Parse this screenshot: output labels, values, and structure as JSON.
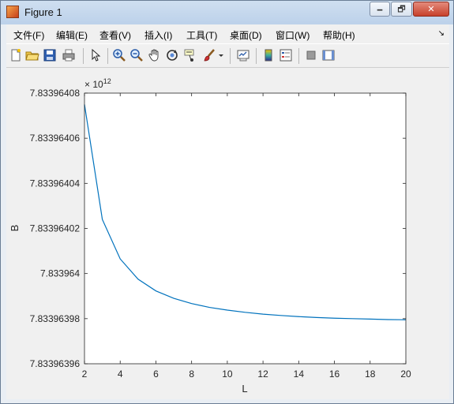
{
  "window": {
    "title": "Figure 1",
    "minimize_symbol": "🗕",
    "maximize_symbol": "🗗",
    "close_symbol": "✕"
  },
  "menu": {
    "items": [
      "文件(F)",
      "编辑(E)",
      "查看(V)",
      "插入(I)",
      "工具(T)",
      "桌面(D)",
      "窗口(W)",
      "帮助(H)"
    ],
    "dock_arrow": "↘"
  },
  "toolbar": {
    "icons": [
      "new-figure-icon",
      "open-file-icon",
      "save-icon",
      "print-icon",
      "pointer-arrow-icon",
      "zoom-in-icon",
      "zoom-out-icon",
      "pan-hand-icon",
      "rotate-3d-icon",
      "data-cursor-icon",
      "brush-icon",
      "brush-dropdown-icon",
      "link-plot-icon",
      "colorbar-icon",
      "legend-icon",
      "hide-plot-tools-icon",
      "show-plot-tools-icon"
    ]
  },
  "chart_data": {
    "type": "line",
    "xlabel": "L",
    "ylabel": "B",
    "exponent_label": "× 10",
    "exponent_power": "12",
    "xlim": [
      2,
      20
    ],
    "ylim": [
      7.83396396,
      7.83396408
    ],
    "xticks": [
      "2",
      "4",
      "6",
      "8",
      "10",
      "12",
      "14",
      "16",
      "18",
      "20"
    ],
    "yticks": [
      "7.83396396",
      "7.83396398",
      "7.833964",
      "7.83396402",
      "7.83396404",
      "7.83396406",
      "7.83396408"
    ],
    "line_color": "#0072bd",
    "series": [
      {
        "x": [
          2,
          3,
          4,
          5,
          6,
          7,
          8,
          9,
          10,
          11,
          12,
          13,
          14,
          15,
          16,
          17,
          18,
          19,
          20
        ],
        "values": [
          7.833964075,
          7.833964024,
          7.8339640065,
          7.8339639975,
          7.8339639923,
          7.833963989,
          7.8339639867,
          7.833963985,
          7.8339639838,
          7.8339639828,
          7.833963982,
          7.8339639814,
          7.8339639809,
          7.8339639805,
          7.8339639802,
          7.83396398,
          7.8339639798,
          7.8339639796,
          7.8339639795
        ]
      }
    ]
  }
}
